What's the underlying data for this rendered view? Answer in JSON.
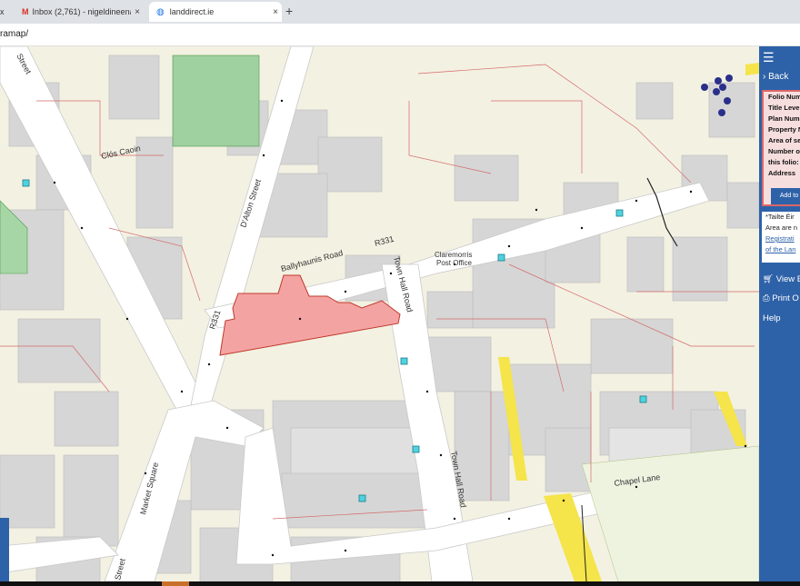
{
  "browser": {
    "tabs": [
      {
        "label": "x",
        "active": false
      },
      {
        "label": "Inbox (2,761) - nigeldineenauct",
        "active": false,
        "icon": "gmail-icon"
      },
      {
        "label": "landdirect.ie",
        "active": true,
        "icon": "globe-icon"
      }
    ],
    "tab_close": "×",
    "new_tab": "+",
    "url": "ramap/"
  },
  "map": {
    "streets": {
      "street_top_left": "Street",
      "clos_caoin": "Clós Caoin",
      "daltoon_street": "D'Alton Street",
      "ballyhaunis_road": "Ballyhaunis Road",
      "r331_a": "R331",
      "r331_b": "R331",
      "town_hall_road_upper": "Town Hall Road",
      "town_hall_road_lower": "Town Hall Road",
      "market_square": "Market Square",
      "chapel_lane": "Chapel Lane",
      "street_bottom": "Street"
    },
    "poi": {
      "post_office_line1": "Claremorris",
      "post_office_line2": "Post Office"
    },
    "highlight_color": "#f4a3a3",
    "highlight_border": "#c0392b"
  },
  "panel": {
    "menu_icon": "☰",
    "back_label": "Back",
    "fields": [
      "Folio Num",
      "Title Level",
      "Plan Num",
      "Property N",
      "Area of se",
      "Number o",
      "this folio:",
      "Address"
    ],
    "add_button": "Add to",
    "note_lines": [
      "*Tailte Éir",
      "Area are n",
      "Registrati",
      "of the Lan"
    ],
    "view_label": "View E",
    "print_label": "Print O",
    "help_label": "Help"
  }
}
